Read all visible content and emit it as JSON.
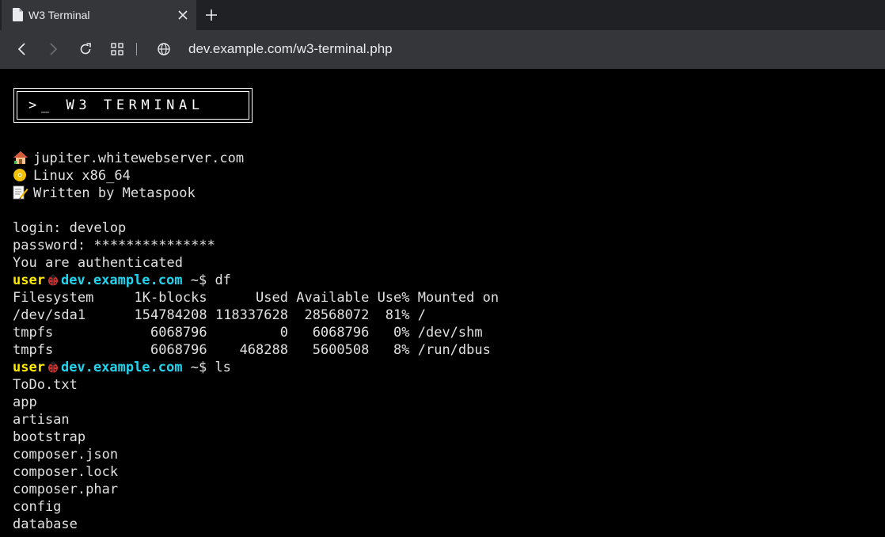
{
  "browser": {
    "tab_title": "W3 Terminal",
    "url": "dev.example.com/w3-terminal.php"
  },
  "terminal": {
    "banner": ">_ W3 TERMINAL",
    "info": [
      {
        "icon": "house-icon",
        "text": "jupiter.whitewebserver.com"
      },
      {
        "icon": "disc-icon",
        "text": "Linux x86_64"
      },
      {
        "icon": "memo-icon",
        "text": "Written by Metaspook"
      }
    ],
    "login_line": "login: develop",
    "password_line": "password: ***************",
    "auth_line": "You are authenticated",
    "prompt": {
      "user": "user",
      "host": "dev.example.com",
      "suffix": " ~$ "
    },
    "commands": [
      {
        "command": "df",
        "output": [
          "Filesystem     1K-blocks      Used Available Use% Mounted on",
          "/dev/sda1      154784208 118337628  28568072  81% /",
          "tmpfs            6068796         0   6068796   0% /dev/shm",
          "tmpfs            6068796    468288   5600508   8% /run/dbus"
        ]
      },
      {
        "command": "ls",
        "output": [
          "ToDo.txt",
          "app",
          "artisan",
          "bootstrap",
          "composer.json",
          "composer.lock",
          "composer.phar",
          "config",
          "database"
        ]
      }
    ]
  },
  "colors": {
    "user": "#ffea00",
    "host": "#22d3ee",
    "background": "#000000",
    "text": "#e0e0e0"
  }
}
